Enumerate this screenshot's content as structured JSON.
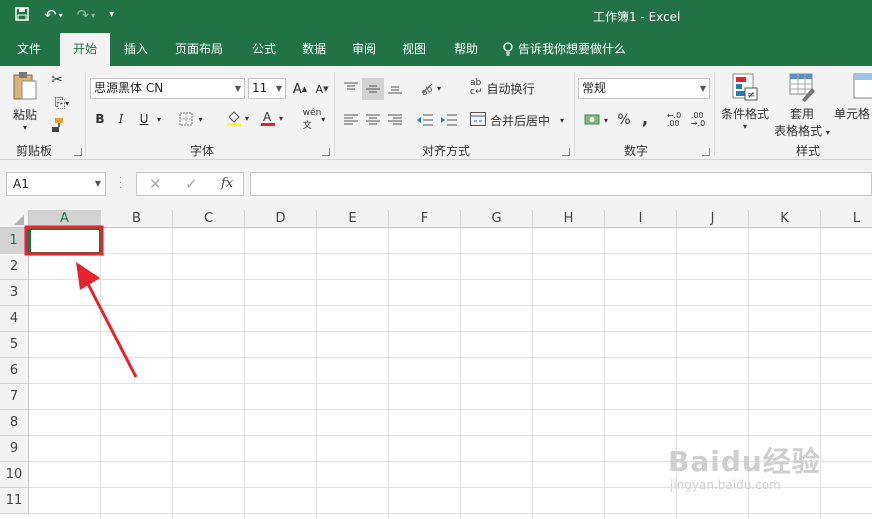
{
  "title": "工作簿1  -  Excel",
  "tabs": [
    "文件",
    "开始",
    "插入",
    "页面布局",
    "公式",
    "数据",
    "审阅",
    "视图",
    "帮助"
  ],
  "tellme": "告诉我你想要做什么",
  "clipboard": {
    "paste": "粘贴",
    "label": "剪贴板"
  },
  "font": {
    "name": "思源黑体 CN",
    "size": "11",
    "label": "字体",
    "bold": "B",
    "italic": "I",
    "underline": "U"
  },
  "alignment": {
    "wrap": "自动换行",
    "merge": "合并后居中",
    "label": "对齐方式"
  },
  "number": {
    "format": "常规",
    "label": "数字",
    "percent": "%",
    "comma": ","
  },
  "styles": {
    "cond": "条件格式",
    "table1": "套用",
    "table2": "表格格式",
    "cell": "单元格",
    "label": "样式"
  },
  "namebox": "A1",
  "fx": "fx",
  "columns": [
    "A",
    "B",
    "C",
    "D",
    "E",
    "F",
    "G",
    "H",
    "I",
    "J",
    "K",
    "L"
  ],
  "rows": [
    "1",
    "2",
    "3",
    "4",
    "5",
    "6",
    "7",
    "8",
    "9",
    "10",
    "11"
  ],
  "watermark": {
    "brand": "Baidu经验",
    "url": "jingyan.baidu.com"
  },
  "colors": {
    "excel_green": "#217346",
    "highlight": "#e8222a"
  }
}
